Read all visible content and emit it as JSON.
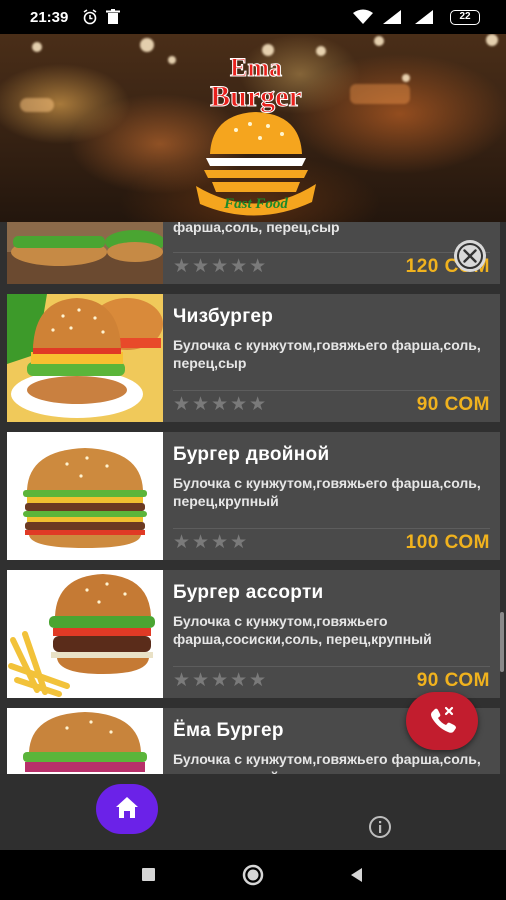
{
  "status_bar": {
    "time": "21:39",
    "battery": "22",
    "icons": [
      "alarm-icon",
      "trash-icon",
      "wifi-icon",
      "signal-icon",
      "signal-icon",
      "battery-icon"
    ]
  },
  "header": {
    "logo_line1": "Ema",
    "logo_line2": "Burger",
    "logo_tagline": "Fast Food"
  },
  "menu_items": [
    {
      "title": "",
      "description": "фарша,соль, перец,сыр",
      "rating": 0,
      "price": "120 СОМ"
    },
    {
      "title": "Чизбургер",
      "description": "Булочка с кунжутом,говяжьего фарша,соль, перец,сыр",
      "rating": 0,
      "price": "90 СОМ"
    },
    {
      "title": "Бургер двойной",
      "description": "Булочка с кунжутом,говяжьего фарша,соль, перец,крупный",
      "rating": 0,
      "price": "100 СОМ"
    },
    {
      "title": "Бургер ассорти",
      "description": "Булочка с кунжутом,говяжьего фарша,сосиски,соль, перец,крупный",
      "rating": 0,
      "price": "90 СОМ"
    },
    {
      "title": "Ёма Бургер",
      "description": "Булочка с кунжутом,говяжьего фарша,соль, перец,крупный",
      "rating": 0,
      "price": ""
    }
  ],
  "star_glyphs": {
    "five": "★★★★★",
    "four": "★★★★"
  },
  "colors": {
    "accent_purple": "#6b22e8",
    "call_red": "#c21d2e",
    "price_gold": "#f0b21e",
    "card_bg": "#4a4a4a"
  }
}
